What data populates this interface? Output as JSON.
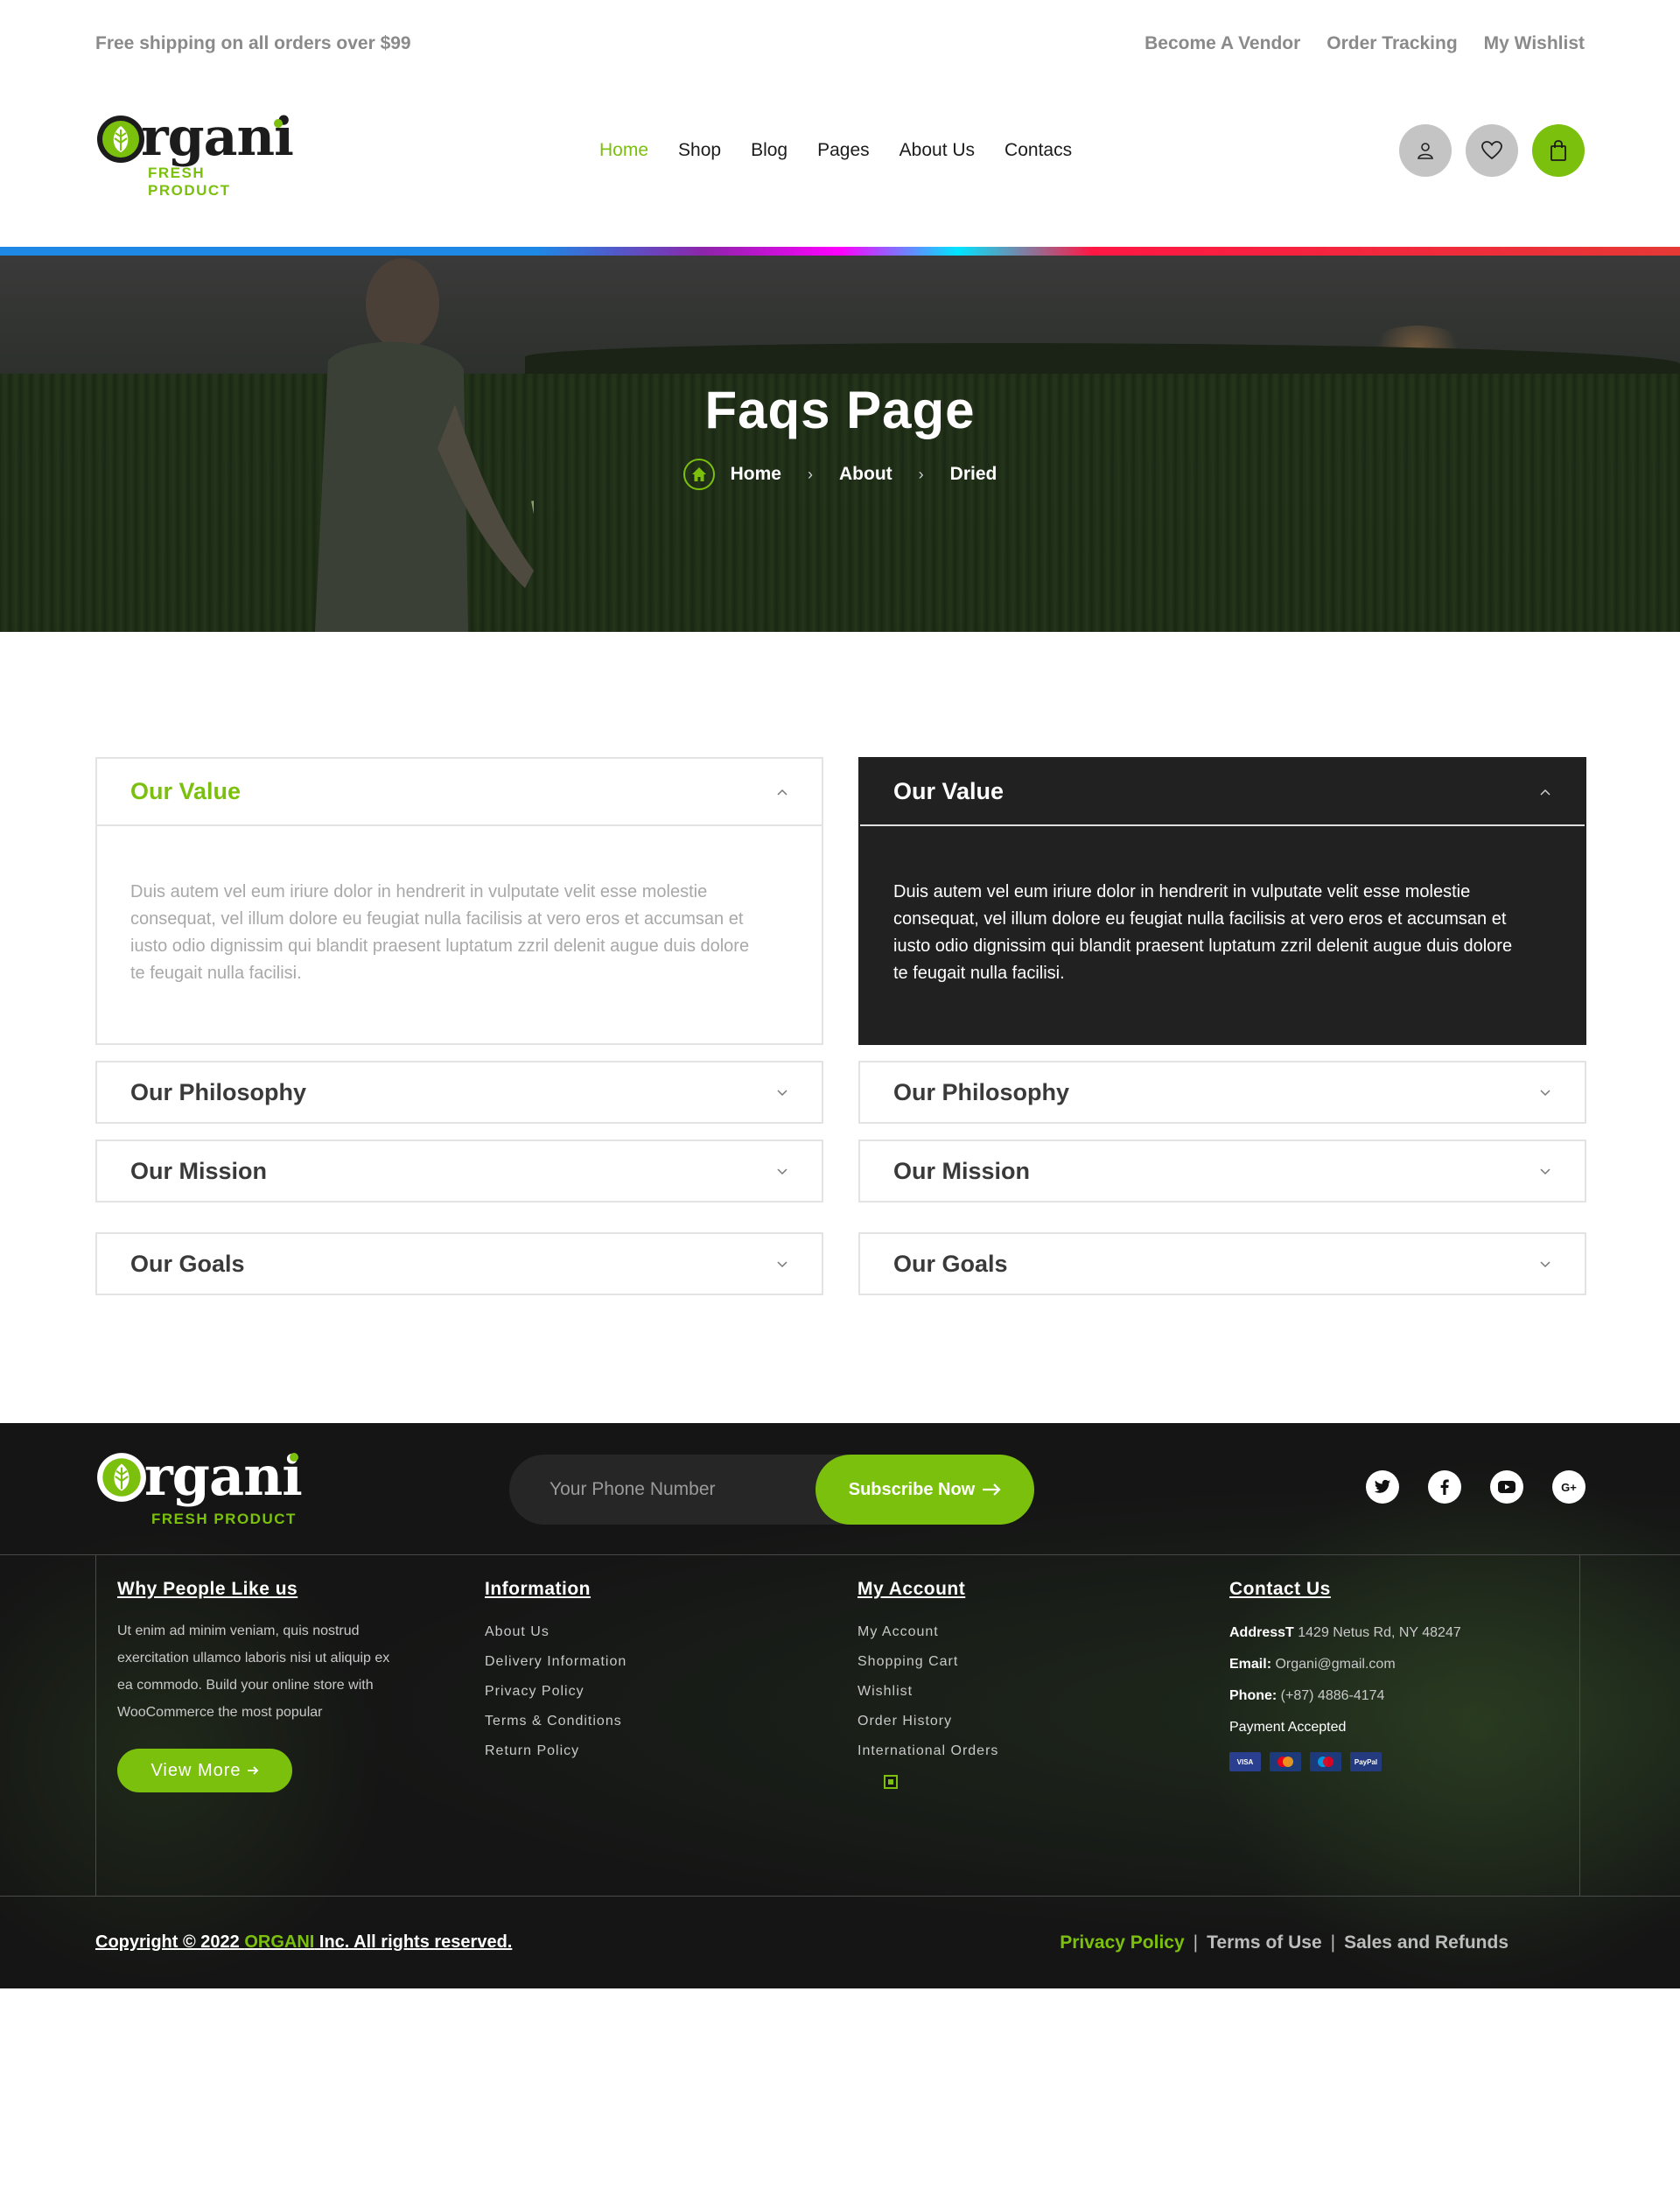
{
  "topbar": {
    "promo": "Free shipping on all orders over $99",
    "links": [
      "Become A Vendor",
      "Order Tracking",
      "My Wishlist"
    ]
  },
  "brand": {
    "name": "rgani",
    "tagline": "FRESH PRODUCT"
  },
  "nav": {
    "items": [
      "Home",
      "Shop",
      "Blog",
      "Pages",
      "About Us",
      "Contacs"
    ],
    "active": "Home"
  },
  "header_icons": [
    "user-icon",
    "heart-icon",
    "shopping-bag-icon"
  ],
  "hero": {
    "title": "Faqs Page",
    "breadcrumb": [
      "Home",
      "About",
      "Dried"
    ]
  },
  "faq": {
    "left": [
      {
        "title": "Our Value",
        "body": "Duis autem vel eum iriure dolor in hendrerit in vulputate velit esse molestie consequat, vel illum dolore eu feugiat nulla facilisis at vero eros et accumsan et iusto odio dignissim qui blandit praesent luptatum zzril delenit augue duis dolore te feugait nulla facilisi.",
        "open": true
      },
      {
        "title": "Our Philosophy",
        "open": false
      },
      {
        "title": "Our Mission",
        "open": false
      },
      {
        "title": "Our Goals",
        "open": false
      }
    ],
    "right": [
      {
        "title": "Our Value",
        "body": "Duis autem vel eum iriure dolor in hendrerit in vulputate velit esse molestie consequat, vel illum dolore eu feugiat nulla facilisis at vero eros et accumsan et iusto odio dignissim qui blandit praesent luptatum zzril delenit augue duis dolore te feugait nulla facilisi.",
        "open": true
      },
      {
        "title": "Our Philosophy",
        "open": false
      },
      {
        "title": "Our Mission",
        "open": false
      },
      {
        "title": "Our Goals",
        "open": false
      }
    ]
  },
  "footer": {
    "subscribe": {
      "placeholder": "Your Phone Number",
      "button": "Subscribe Now"
    },
    "social": [
      "twitter-icon",
      "facebook-icon",
      "youtube-icon",
      "google-plus-icon"
    ],
    "why": {
      "title": "Why People Like us",
      "text": "Ut enim ad minim veniam, quis nostrud exercitation ullamco laboris nisi ut aliquip ex ea commodo. Build your online store with WooCommerce the most popular",
      "button": "View More"
    },
    "information": {
      "title": "Information",
      "items": [
        "About Us",
        "Delivery Information",
        "Privacy Policy",
        "Terms & Conditions",
        "Return Policy"
      ]
    },
    "account": {
      "title": "My Account",
      "items": [
        "My Account",
        "Shopping Cart",
        "Wishlist",
        "Order History",
        "International Orders"
      ]
    },
    "contact": {
      "title": "Contact Us",
      "address_label": "AddressT",
      "address": "1429 Netus Rd, NY 48247",
      "email_label": "Email:",
      "email": "Organi@gmail.com",
      "phone_label": "Phone:",
      "phone": "(+87) 4886-4174",
      "payment_label": "Payment Accepted",
      "cards": [
        "VISA",
        "MC",
        "MAESTRO",
        "PayPal"
      ]
    },
    "copyright": {
      "prefix": "Copyright © 2022 ",
      "brand": "ORGANI",
      "suffix": " Inc. All rights reserved."
    },
    "legal": [
      "Privacy Policy",
      "Terms of Use",
      "Sales and Refunds"
    ]
  },
  "colors": {
    "accent": "#7cc00e",
    "dark": "#212121",
    "footer": "#141414"
  }
}
